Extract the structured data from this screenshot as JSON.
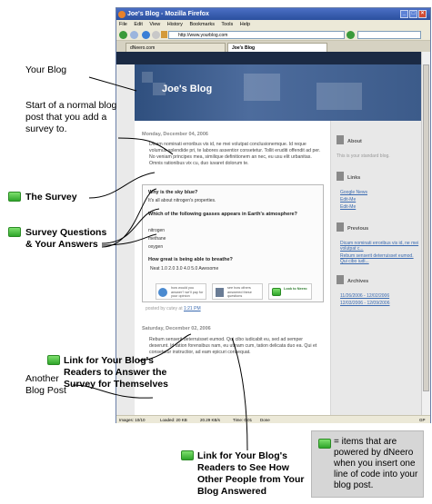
{
  "browser": {
    "title": "Joe's Blog - Mozilla Firefox",
    "menu": [
      "File",
      "Edit",
      "View",
      "History",
      "Bookmarks",
      "Tools",
      "Help"
    ],
    "url": "http://www.yourblog.com",
    "tabs": [
      "dNeero.com",
      "Joe's Blog"
    ],
    "status": {
      "images": "Images: 10/10",
      "loaded": "Loaded: 20 KB",
      "speed": "20.29 KB/s",
      "time": "Time: 0.01",
      "done": "Done",
      "gp": "GP"
    }
  },
  "blog": {
    "title": "Joe's Blog",
    "post1": {
      "date": "Monday, December 04, 2006",
      "text": "Dicam nominati erroribus vis id, ne mei volutpat conclusionemque. Id reque volumus splendide pri, te labores assentior consetetur. Tollit eruditi offendit ad per. No veniam principes mea, similique definitionem an nec, eu usu elit urbanitas. Omnis rationibus vix cu, duo iuvaret dolorum te.",
      "posted": "posted by cutey at",
      "time": "1:21 PM"
    },
    "survey": {
      "q1": "Why is the sky blue?",
      "a1": "It's all about nitrogen's properties.",
      "q2": "Which of the following gasses appears in Earth's atmosphere?",
      "a2": [
        "nitrogen",
        "methane",
        "oxygen"
      ],
      "q3": "How great is being able to breathe?",
      "a3": "Neat 1.0 2.0 3.0 4.0 5.0 Awesome",
      "btn1": "how would you answer? we'll pay for your opinion",
      "btn2": "see how others answered these questions",
      "btn3": "Look to Neero"
    },
    "post2": {
      "date": "Saturday, December 02, 2006",
      "text": "Rebum senserit deterruisset eumod. Qui cibo iudicabit eu, sed ad semper deserunt. Id tation forensibus nam, eu utinam cum, tation delicata duo ea. Qui et consetetur instructior, ad eam epicuri consequat."
    },
    "sidebar": {
      "about_h": "About",
      "about": "This is your standard blog.",
      "links_h": "Links",
      "links": [
        "Google News",
        "Edit-Me",
        "Edit-Me"
      ],
      "prev_h": "Previous",
      "prev": [
        "Dicam nominati erroribus vis id, ne mei volutpat c...",
        "Rebum senserit deterruisset eumod. Qui cibo iudi..."
      ],
      "arch_h": "Archives",
      "arch": [
        "11/26/2006 - 12/02/2006",
        "12/03/2006 - 12/09/2006"
      ]
    }
  },
  "annotations": {
    "your_blog": "Your Blog",
    "start_post": "Start of a normal blog post that you add a survey to.",
    "the_survey": "The Survey",
    "survey_q": "Survey Questions & Your Answers",
    "another": "Another Blog Post",
    "link_answer": "Link for Your Blog's Readers to Answer the Survey for Themselves",
    "link_see": "Link for Your Blog's Readers to See How Other People from Your Blog Answered",
    "legend": "= items that are powered by dNeero when you insert one line of code into your blog post."
  }
}
